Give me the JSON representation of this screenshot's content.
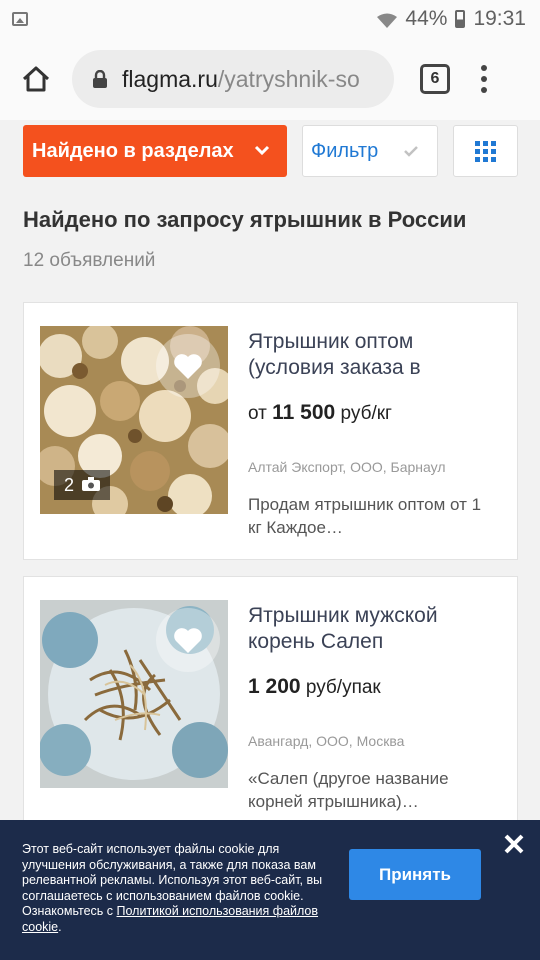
{
  "status_bar": {
    "battery": "44%",
    "time": "19:31"
  },
  "browser": {
    "url_domain": "flagma.ru",
    "url_path": "/yatryshnik-so",
    "tabs_count": "6"
  },
  "toolbar": {
    "found_label": "Найдено в разделах",
    "filter_label": "Фильтр"
  },
  "search": {
    "heading": "Найдено по запросу ятрышник в России",
    "count": "12 объявлений"
  },
  "listings": [
    {
      "title": "Ятрышник оптом (условия заказа в",
      "price_prefix": "от",
      "price_value": "11 500",
      "price_unit": "руб/кг",
      "seller": "Алтай Экспорт, ООО, Барнаул",
      "description": "Продам ятрышник оптом от 1 кг Каждое…",
      "photo_count": "2"
    },
    {
      "title": "Ятрышник мужской корень Салеп",
      "price_value": "1 200",
      "price_unit": "руб/упак",
      "seller": "Авангард, ООО, Москва",
      "description": "«Салеп (другое название корней ятрышника)…"
    }
  ],
  "cookie": {
    "text": "Этот веб-сайт использует файлы cookie для улучшения обслуживания, а также для показа вам релевантной рекламы. Используя этот веб-сайт, вы соглашаетесь с использованием файлов cookie. Ознакомьтесь с",
    "link": "Политикой использования файлов cookie",
    "end": ".",
    "accept": "Принять"
  },
  "colors": {
    "accent_orange": "#f4511e",
    "link_blue": "#2079d4",
    "cookie_bg": "#1c2b4a",
    "accept_blue": "#2e88e6"
  }
}
